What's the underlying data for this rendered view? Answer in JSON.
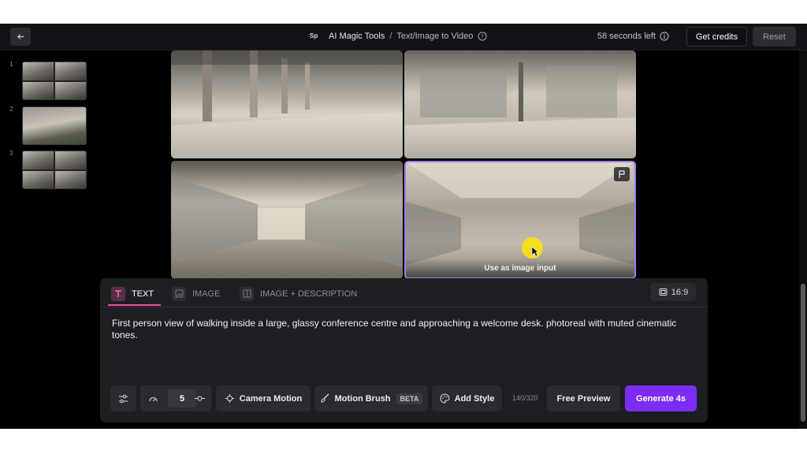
{
  "header": {
    "logo_text": "Sp",
    "app_name": "AI Magic Tools",
    "separator": "/",
    "page_name": "Text/Image to Video",
    "timer": "58 seconds left",
    "credits_label": "Get credits",
    "reset_label": "Reset"
  },
  "sidebar": {
    "items": [
      {
        "number": "1"
      },
      {
        "number": "2"
      },
      {
        "number": "3"
      }
    ]
  },
  "gallery": {
    "use_as_input_label": "Use as image input"
  },
  "prompt_panel": {
    "tabs": [
      {
        "label": "TEXT",
        "active": true
      },
      {
        "label": "IMAGE",
        "active": false
      },
      {
        "label": "IMAGE + DESCRIPTION",
        "active": false
      }
    ],
    "aspect_ratio": "16:9",
    "prompt_text": "First person view of walking inside a large, glassy conference centre and approaching a welcome desk.  photoreal with muted cinematic tones.",
    "speed_value": "5",
    "camera_motion_label": "Camera Motion",
    "motion_brush_label": "Motion Brush",
    "beta_badge": "BETA",
    "add_style_label": "Add Style",
    "char_count": "140/320",
    "free_preview_label": "Free Preview",
    "generate_label": "Generate 4s"
  },
  "colors": {
    "accent": "#7c2cf5",
    "tab_underline": "#e94da0",
    "selected_border": "#9b7ee8",
    "cursor_highlight": "#f8e019"
  }
}
